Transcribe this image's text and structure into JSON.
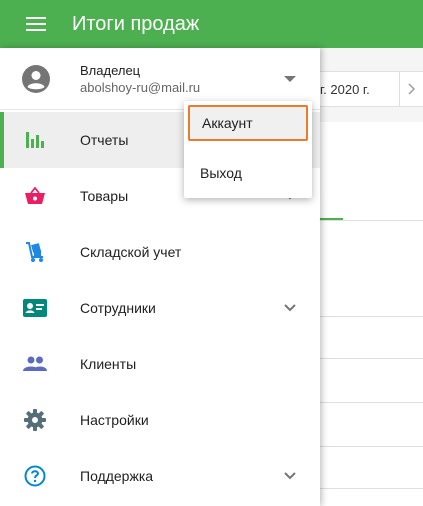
{
  "appbar": {
    "title": "Итоги продаж"
  },
  "background": {
    "date_label": "г. 2020 г."
  },
  "account": {
    "name": "Владелец",
    "email": "abolshoy-ru@mail.ru"
  },
  "nav": {
    "items": [
      {
        "label": "Отчеты",
        "icon": "bar-chart-icon",
        "active": true
      },
      {
        "label": "Товары",
        "icon": "basket-icon"
      },
      {
        "label": "Складской учет",
        "icon": "warehouse-cart-icon"
      },
      {
        "label": "Сотрудники",
        "icon": "badge-icon"
      },
      {
        "label": "Клиенты",
        "icon": "people-icon"
      },
      {
        "label": "Настройки",
        "icon": "gear-icon"
      },
      {
        "label": "Поддержка",
        "icon": "help-icon"
      }
    ]
  },
  "account_menu": {
    "items": [
      {
        "label": "Аккаунт"
      },
      {
        "label": "Выход"
      }
    ]
  },
  "colors": {
    "primary": "#4caf50",
    "highlight": "#e87b2c"
  }
}
